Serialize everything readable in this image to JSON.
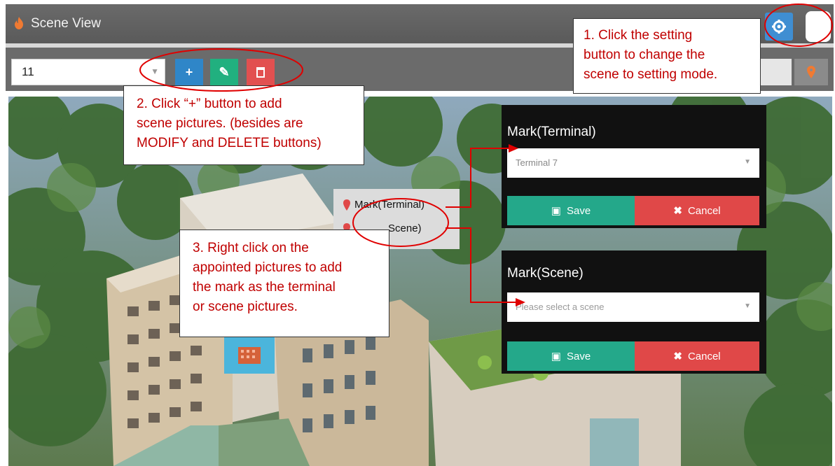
{
  "window": {
    "title": "Scene View"
  },
  "toolbar": {
    "scene_select_value": "11",
    "add_label": "+",
    "edit_label": "✎",
    "delete_label": "🗑"
  },
  "callouts": {
    "step1": [
      "1.  Click  the  setting",
      "button  to  change  the",
      "scene to setting mode."
    ],
    "step2": [
      "2.  Click  “+”  button  to  add",
      "scene  pictures.  (besides  are",
      "MODIFY and DELETE buttons)"
    ],
    "step3": [
      "3.  Right  click  on  the",
      "appointed pictures to add",
      "the  mark  as  the  terminal",
      "or scene pictures."
    ]
  },
  "context_menu": {
    "items": [
      "Mark(Terminal)",
      "Mark(Scene)"
    ],
    "visible_scene_text": "Scene)"
  },
  "panels": {
    "terminal": {
      "title": "Mark(Terminal)",
      "select_value": "Terminal 7",
      "save_label": "Save",
      "cancel_label": "Cancel"
    },
    "scene": {
      "title": "Mark(Scene)",
      "select_placeholder": "Please select a scene",
      "save_label": "Save",
      "cancel_label": "Cancel"
    }
  },
  "colors": {
    "annotation_red": "#e00000",
    "add_blue": "#2f86c8",
    "edit_green": "#21b07f",
    "delete_red": "#e25050",
    "save_green": "#24a88a",
    "cancel_red": "#e04848"
  }
}
